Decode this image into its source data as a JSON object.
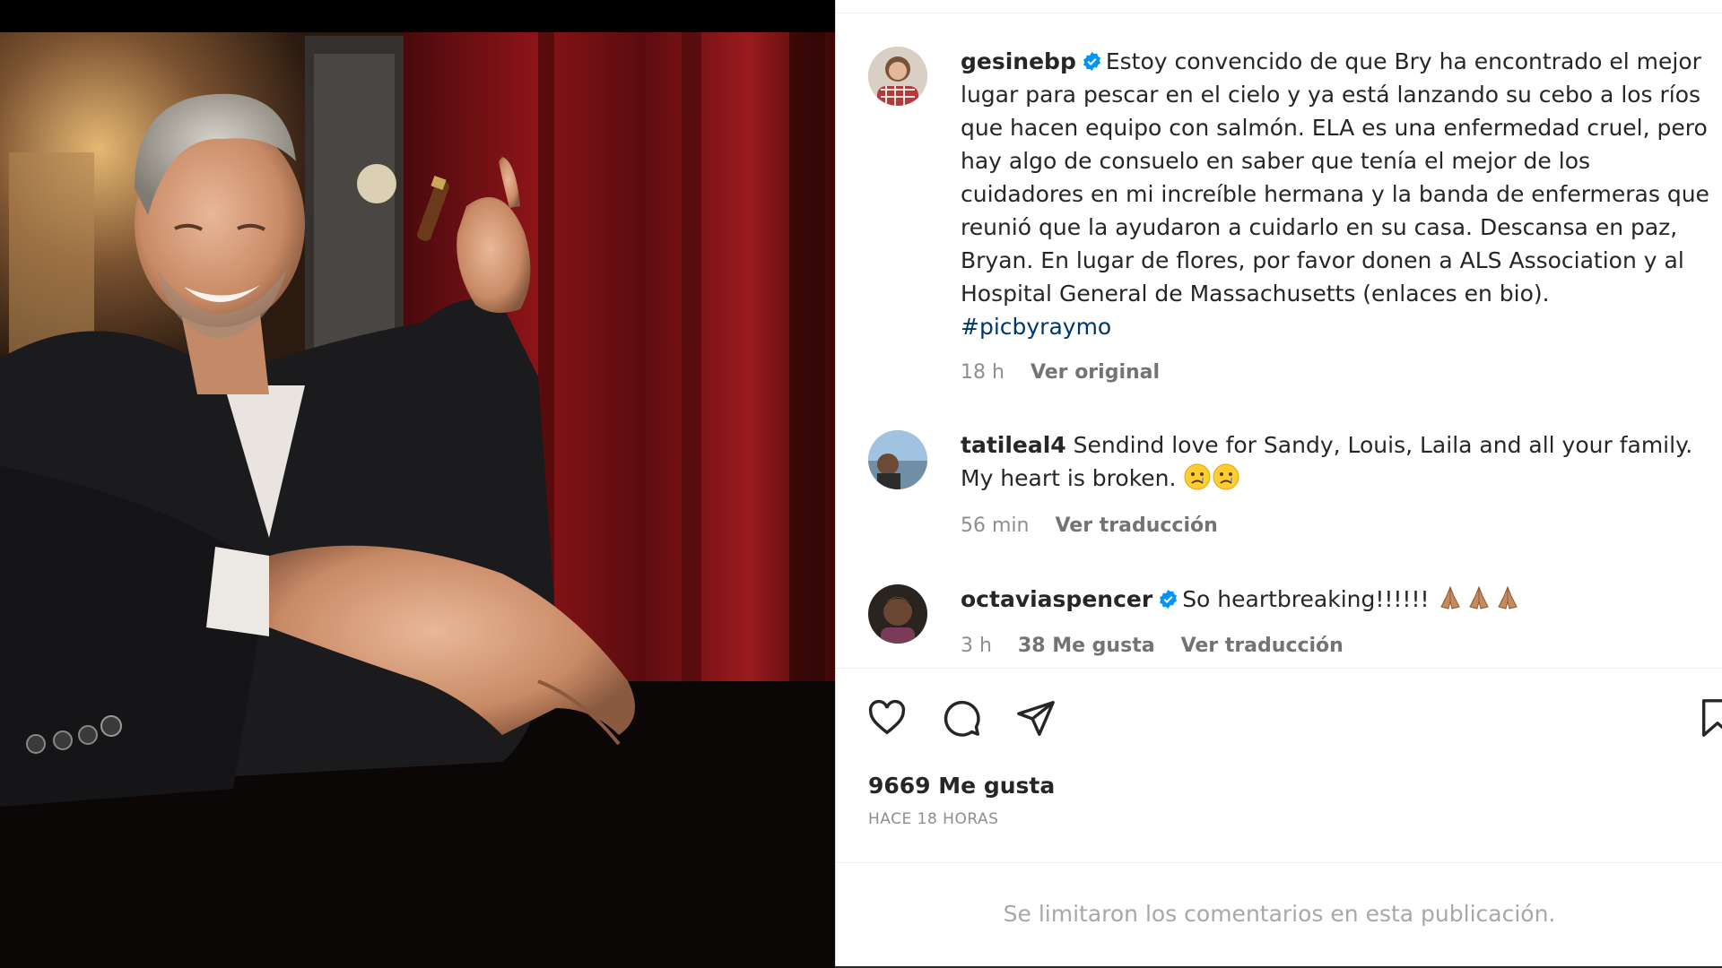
{
  "photo": {
    "alt_icon": "post-photo"
  },
  "caption": {
    "username": "gesinebp",
    "verified": true,
    "text": "Estoy convencido de que Bry ha encontrado el mejor lugar para pescar en el cielo y ya está lanzando su cebo a los ríos que hacen equipo con salmón. ELA es una enfermedad cruel, pero hay algo de consuelo en saber que tenía el mejor de los cuidadores en mi increíble hermana y la banda de enfermeras que reunió que la ayudaron a cuidarlo en su casa. Descansa en paz, Bryan. En lugar de flores, por favor donen a ALS Association y al Hospital General de Massachusetts (enlaces en bio).",
    "hashtag": "#picbyraymo",
    "time": "18 h",
    "action": "Ver original"
  },
  "comments": [
    {
      "username": "tatileal4",
      "verified": false,
      "text": "Sendind love for Sandy, Louis, Laila and all your family. My heart is broken.",
      "emojis": [
        "crying-face-emoji",
        "crying-face-emoji"
      ],
      "time": "56 min",
      "action": "Ver traducción"
    },
    {
      "username": "octaviaspencer",
      "verified": true,
      "text": "So heartbreaking!!!!!!",
      "emojis": [
        "praying-hands-emoji",
        "praying-hands-emoji",
        "praying-hands-emoji"
      ],
      "time": "3 h",
      "likes": "38 Me gusta",
      "action": "Ver traducción"
    }
  ],
  "actions": {
    "icons": [
      "heart-icon",
      "comment-icon",
      "share-icon",
      "bookmark-icon"
    ]
  },
  "likes": "9669 Me gusta",
  "timestamp": "HACE 18 HORAS",
  "comments_limited": "Se limitaron los comentarios en esta publicación.",
  "colors": {
    "link": "#00376b",
    "verified": "#0095f6",
    "meta": "#8e8e8e"
  }
}
